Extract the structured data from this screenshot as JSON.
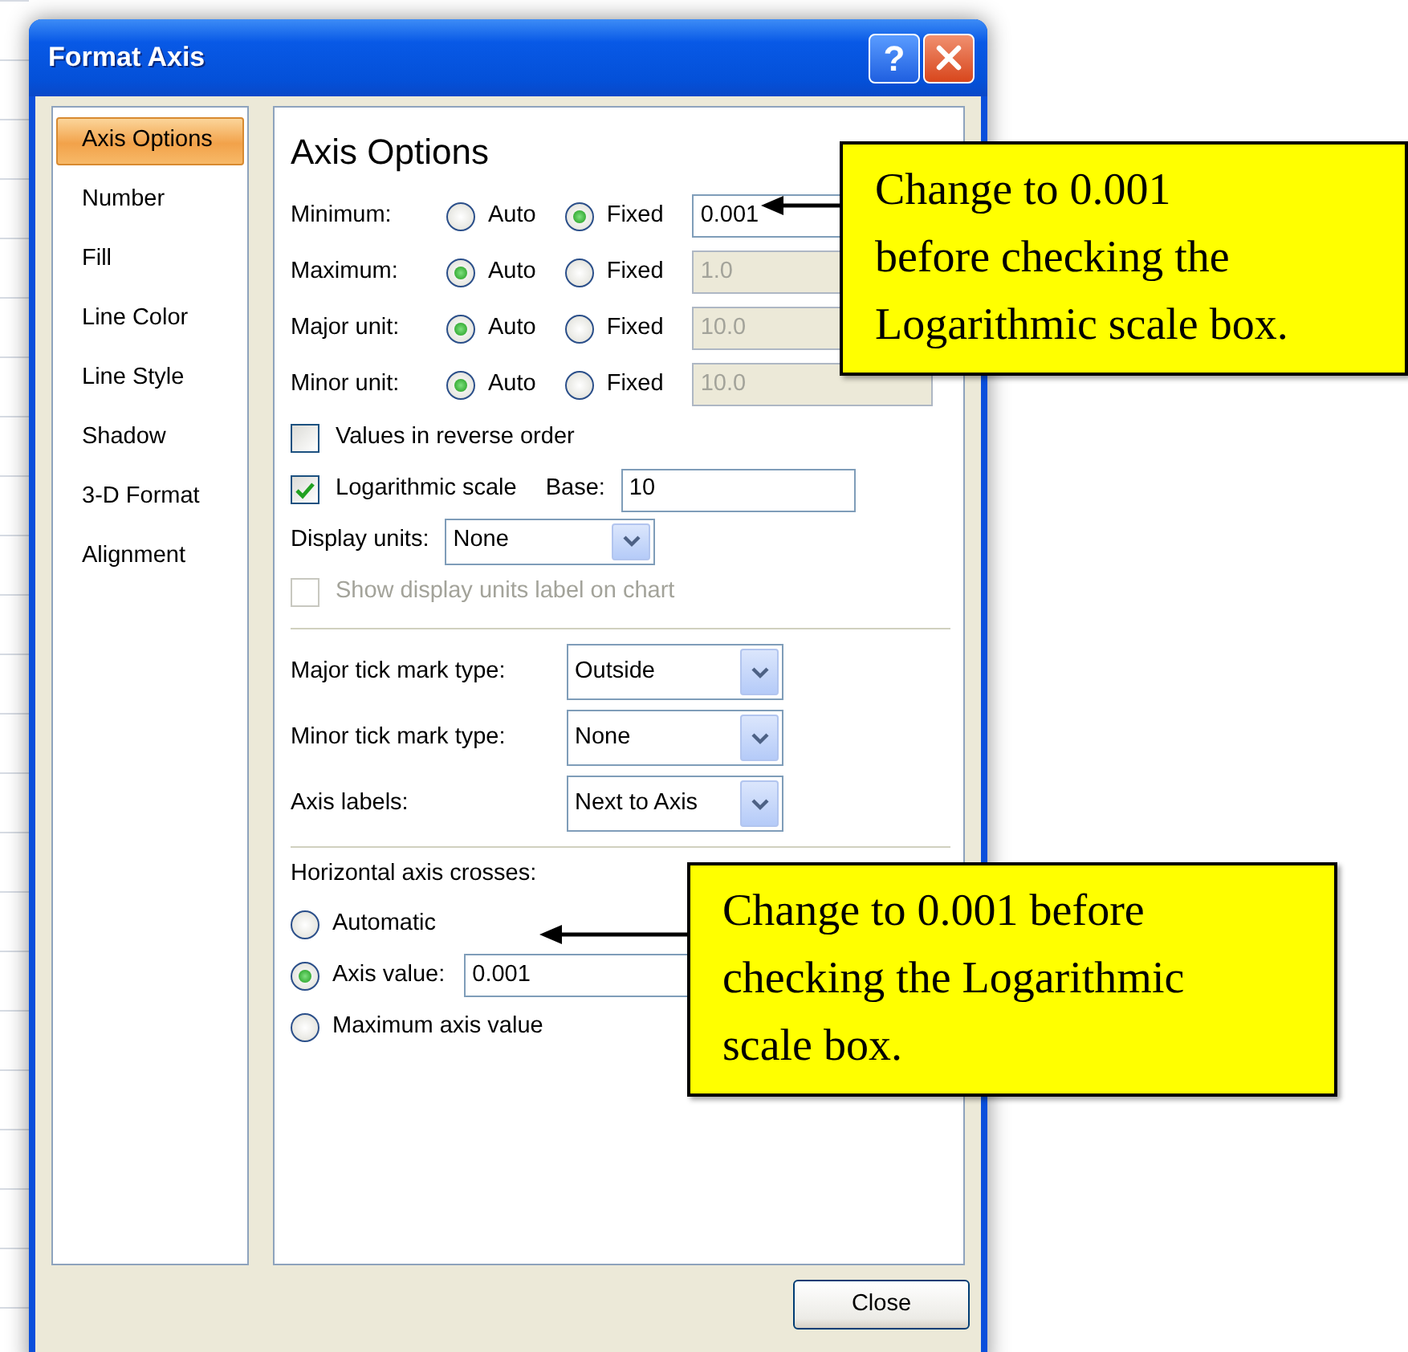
{
  "window": {
    "title": "Format Axis",
    "help": "?"
  },
  "sidebar": {
    "items": [
      {
        "label": "Axis Options",
        "selected": true
      },
      {
        "label": "Number",
        "selected": false
      },
      {
        "label": "Fill",
        "selected": false
      },
      {
        "label": "Line Color",
        "selected": false
      },
      {
        "label": "Line Style",
        "selected": false
      },
      {
        "label": "Shadow",
        "selected": false
      },
      {
        "label": "3-D Format",
        "selected": false
      },
      {
        "label": "Alignment",
        "selected": false
      }
    ]
  },
  "panel": {
    "title": "Axis Options",
    "scale_rows": [
      {
        "label": "Minimum:",
        "auto": {
          "label": "Auto",
          "selected": false
        },
        "fixed": {
          "label": "Fixed",
          "selected": true
        },
        "value": "0.001"
      },
      {
        "label": "Maximum:",
        "auto": {
          "label": "Auto",
          "selected": true
        },
        "fixed": {
          "label": "Fixed",
          "selected": false
        },
        "value": "1.0"
      },
      {
        "label": "Major unit:",
        "auto": {
          "label": "Auto",
          "selected": true
        },
        "fixed": {
          "label": "Fixed",
          "selected": false
        },
        "value": "10.0"
      },
      {
        "label": "Minor unit:",
        "auto": {
          "label": "Auto",
          "selected": true
        },
        "fixed": {
          "label": "Fixed",
          "selected": false
        },
        "value": "10.0"
      }
    ],
    "options": [
      {
        "kind": "checkbox",
        "label": "Values in reverse order",
        "checked": false,
        "disabled": false
      },
      {
        "kind": "checkbox_field",
        "label": "Logarithmic scale",
        "checked": true,
        "disabled": false,
        "field_label": "Base:",
        "value": "10"
      },
      {
        "kind": "dropdown",
        "label": "Display units:",
        "value": "None"
      },
      {
        "kind": "checkbox",
        "label": "Show display units label on chart",
        "checked": false,
        "disabled": true
      }
    ],
    "tick_rows": [
      {
        "label": "Major tick mark type:",
        "value": "Outside"
      },
      {
        "label": "Minor tick mark type:",
        "value": "None"
      },
      {
        "label": "Axis labels:",
        "value": "Next to Axis"
      }
    ],
    "crosses": {
      "label": "Horizontal axis crosses:",
      "options": [
        {
          "label": "Automatic",
          "selected": false
        },
        {
          "label": "Axis value:",
          "selected": true,
          "value": "0.001"
        },
        {
          "label": "Maximum axis value",
          "selected": false
        }
      ]
    }
  },
  "close_button": "Close",
  "callouts": [
    {
      "lines": [
        "Change to 0.001",
        "before checking the",
        "Logarithmic scale box."
      ]
    },
    {
      "lines": [
        "Change to 0.001 before",
        "checking the Logarithmic",
        "scale box."
      ]
    }
  ]
}
